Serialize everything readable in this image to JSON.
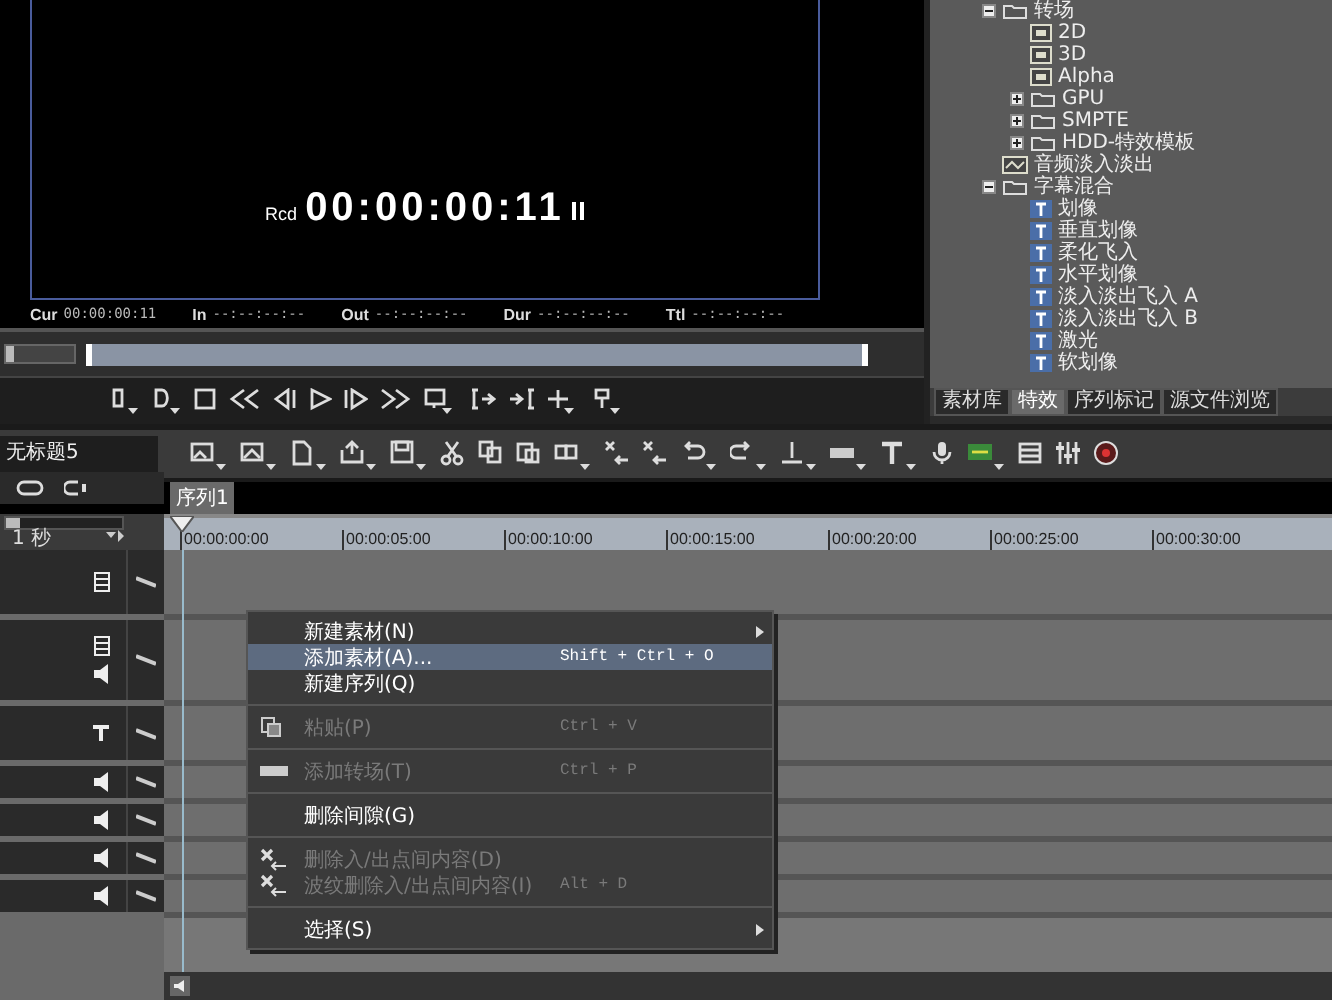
{
  "player": {
    "recorder_label": "Rcd",
    "timecode": "00:00:00:11",
    "readouts": [
      {
        "label": "Cur",
        "value": "00:00:00:11"
      },
      {
        "label": "In",
        "value": "--:--:--:--"
      },
      {
        "label": "Out",
        "value": "--:--:--:--"
      },
      {
        "label": "Dur",
        "value": "--:--:--:--"
      },
      {
        "label": "Ttl",
        "value": "--:--:--:--"
      }
    ]
  },
  "effects_tree": [
    {
      "kind": "folder",
      "label": "转场",
      "expanded": true,
      "children": [
        {
          "kind": "transition",
          "label": "2D"
        },
        {
          "kind": "transition",
          "label": "3D"
        },
        {
          "kind": "transition",
          "label": "Alpha"
        },
        {
          "kind": "folder",
          "label": "GPU",
          "expanded": false
        },
        {
          "kind": "folder",
          "label": "SMPTE",
          "expanded": false
        },
        {
          "kind": "folder",
          "label": "HDD-特效模板",
          "expanded": false
        }
      ]
    },
    {
      "kind": "audio",
      "label": "音频淡入淡出"
    },
    {
      "kind": "folder",
      "label": "字幕混合",
      "expanded": true,
      "children": [
        {
          "kind": "title",
          "label": "划像"
        },
        {
          "kind": "title",
          "label": "垂直划像"
        },
        {
          "kind": "title",
          "label": "柔化飞入"
        },
        {
          "kind": "title",
          "label": "水平划像"
        },
        {
          "kind": "title",
          "label": "淡入淡出飞入 A"
        },
        {
          "kind": "title",
          "label": "淡入淡出飞入 B"
        },
        {
          "kind": "title",
          "label": "激光"
        },
        {
          "kind": "title",
          "label": "软划像"
        }
      ]
    }
  ],
  "bin_tabs": [
    {
      "label": "素材库",
      "selected": false
    },
    {
      "label": "特效",
      "selected": true
    },
    {
      "label": "序列标记",
      "selected": false
    },
    {
      "label": "源文件浏览",
      "selected": false
    }
  ],
  "shuttle": {
    "level": 0.12
  },
  "project_name": "无标题5",
  "zoom_slider": {
    "level": 0.12
  },
  "sequence_tabs": [
    {
      "label": "序列1",
      "selected": true
    }
  ],
  "zoom_label": "1 秒",
  "ruler": [
    "00:00:00:00",
    "00:00:05:00",
    "00:00:10:00",
    "00:00:15:00",
    "00:00:20:00",
    "00:00:25:00",
    "00:00:30:00"
  ],
  "tracks": [
    {
      "kind": "video"
    },
    {
      "kind": "video-audio"
    },
    {
      "kind": "title"
    },
    {
      "kind": "audio"
    },
    {
      "kind": "audio"
    },
    {
      "kind": "audio"
    },
    {
      "kind": "audio"
    }
  ],
  "context_menu": {
    "items": [
      {
        "kind": "item",
        "label": "新建素材(N)",
        "selected": false,
        "disabled": false,
        "submenu": true
      },
      {
        "kind": "item",
        "label": "添加素材(A)...",
        "shortcut": "Shift + Ctrl + O",
        "selected": true,
        "disabled": false,
        "submenu": false
      },
      {
        "kind": "item",
        "label": "新建序列(Q)",
        "selected": false,
        "disabled": false,
        "submenu": false
      },
      {
        "kind": "separator"
      },
      {
        "kind": "item",
        "label": "粘贴(P)",
        "shortcut": "Ctrl + V",
        "selected": false,
        "disabled": true,
        "submenu": false
      },
      {
        "kind": "separator"
      },
      {
        "kind": "item",
        "label": "添加转场(T)",
        "shortcut": "Ctrl + P",
        "selected": false,
        "disabled": true,
        "submenu": false
      },
      {
        "kind": "separator"
      },
      {
        "kind": "item",
        "label": "删除间隙(G)",
        "selected": false,
        "disabled": false,
        "submenu": false
      },
      {
        "kind": "separator"
      },
      {
        "kind": "item",
        "label": "删除入/出点间内容(D)",
        "selected": false,
        "disabled": true,
        "submenu": false
      },
      {
        "kind": "item",
        "label": "波纹删除入/出点间内容(I)",
        "shortcut": "Alt + D",
        "selected": false,
        "disabled": true,
        "submenu": false
      },
      {
        "kind": "separator"
      },
      {
        "kind": "item",
        "label": "选择(S)",
        "selected": false,
        "disabled": false,
        "submenu": true
      }
    ]
  }
}
